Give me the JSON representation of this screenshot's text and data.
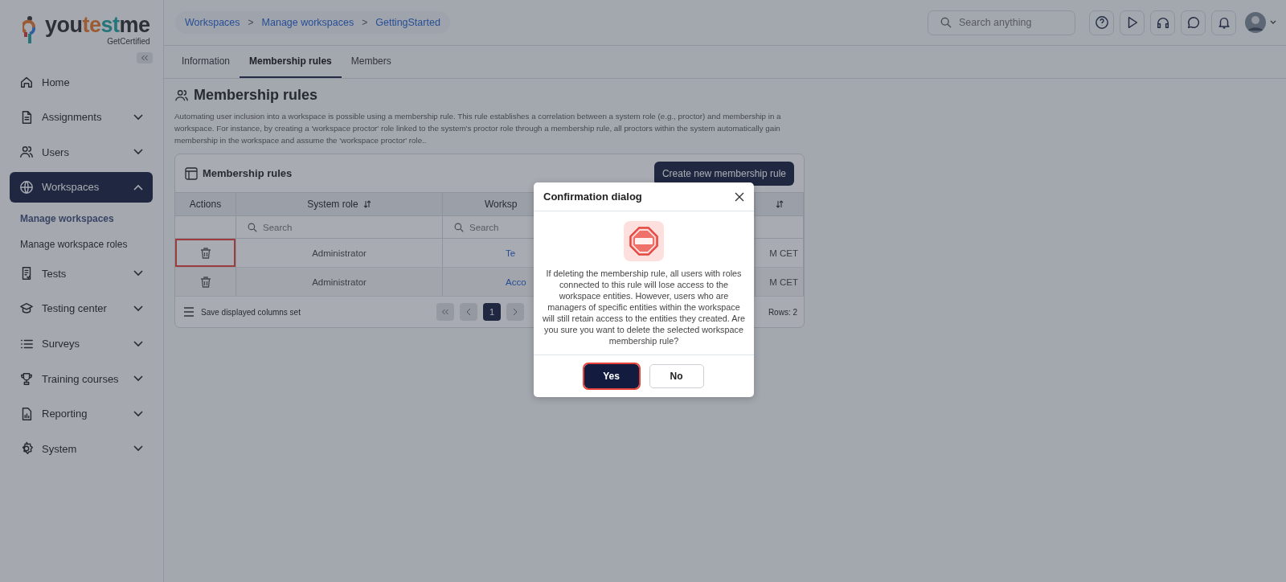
{
  "logo": {
    "parts": [
      "you",
      "te",
      "st",
      "me"
    ],
    "tagline": "GetCertified"
  },
  "sidebar": {
    "items": [
      {
        "label": "Home",
        "expandable": false,
        "selected": false
      },
      {
        "label": "Assignments",
        "expandable": true,
        "expanded": false,
        "selected": false
      },
      {
        "label": "Users",
        "expandable": true,
        "expanded": false,
        "selected": false
      },
      {
        "label": "Workspaces",
        "expandable": true,
        "expanded": true,
        "selected": true,
        "children": [
          {
            "label": "Manage workspaces",
            "selected": true
          },
          {
            "label": "Manage workspace roles",
            "selected": false
          }
        ]
      },
      {
        "label": "Tests",
        "expandable": true,
        "expanded": false,
        "selected": false
      },
      {
        "label": "Testing center",
        "expandable": true,
        "expanded": false,
        "selected": false
      },
      {
        "label": "Surveys",
        "expandable": true,
        "expanded": false,
        "selected": false
      },
      {
        "label": "Training courses",
        "expandable": true,
        "expanded": false,
        "selected": false
      },
      {
        "label": "Reporting",
        "expandable": true,
        "expanded": false,
        "selected": false
      },
      {
        "label": "System",
        "expandable": true,
        "expanded": false,
        "selected": false
      }
    ]
  },
  "breadcrumbs": [
    {
      "label": "Workspaces"
    },
    {
      "separator": ">",
      "label": "Manage workspaces"
    },
    {
      "separator": ">",
      "label": "GettingStarted"
    }
  ],
  "search": {
    "placeholder": "Search anything"
  },
  "tabs": [
    {
      "label": "Information",
      "selected": false
    },
    {
      "label": "Membership rules",
      "selected": true
    },
    {
      "label": "Members",
      "selected": false
    }
  ],
  "page_title": "Membership rules",
  "description": "Automating user inclusion into a workspace is possible using a membership rule. This rule establishes a correlation between a system role (e.g., proctor) and membership in a workspace. For instance, by creating a 'workspace proctor' role linked to the system's proctor role through a membership rule, all proctors within the system automatically gain membership in the workspace and assume the 'workspace proctor' role..",
  "card": {
    "title": "Membership rules",
    "create_button": "Create new membership rule"
  },
  "table": {
    "columns": [
      {
        "label": "Actions",
        "sortable": false
      },
      {
        "label": "System role",
        "sortable": true
      },
      {
        "label": "Worksp",
        "sortable": false
      },
      {
        "sortable": true
      }
    ],
    "filters": [
      {
        "placeholder": "Search"
      },
      {
        "placeholder": "Search"
      }
    ],
    "rows": [
      {
        "highlighted": true,
        "system_role": "Administrator",
        "column_3": "Te",
        "column_4": "M CET"
      },
      {
        "highlighted": false,
        "system_role": "Administrator",
        "column_3": "Acco",
        "column_4": "M CET"
      }
    ],
    "footer": {
      "save_columns": "Save displayed columns set",
      "pages": [
        {
          "label": "1",
          "selected": true
        }
      ],
      "rows_count": "Rows: 2"
    }
  },
  "dialog": {
    "title": "Confirmation dialog",
    "message": "If deleting the membership rule, all users with roles connected to this rule will lose access to the workspace entities. However, users who are managers of specific entities within the workspace will still retain access to the entities they created. Are you sure you want to delete the selected workspace membership rule?",
    "buttons": [
      {
        "label": "Yes",
        "kind": "primary",
        "highlighted": true
      },
      {
        "label": "No",
        "kind": "secondary",
        "highlighted": false
      }
    ]
  }
}
